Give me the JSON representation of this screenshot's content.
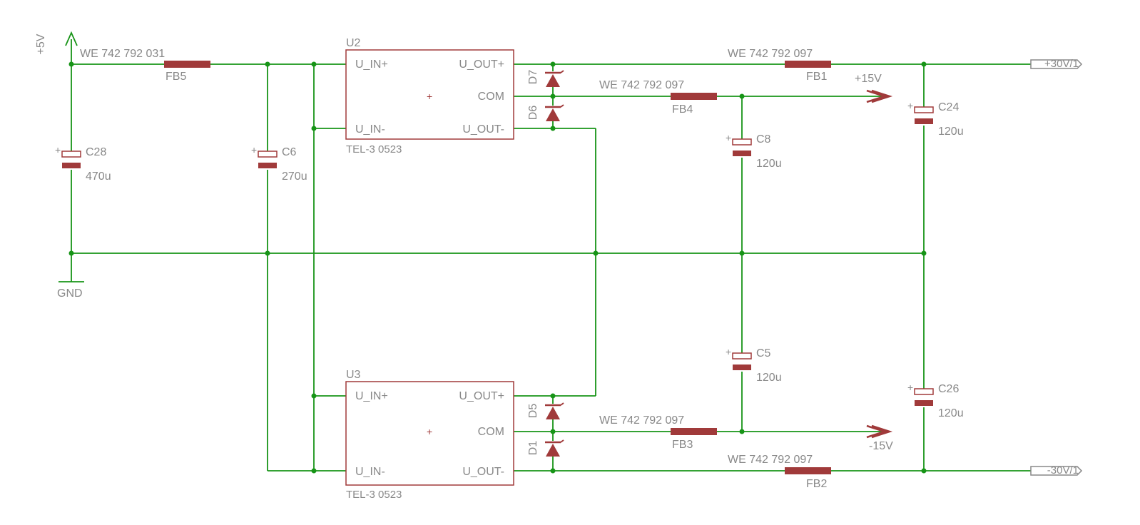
{
  "rails": {
    "plus5v": "+5V",
    "gnd": "GND",
    "plus15v": "+15V",
    "minus15v": "-15V",
    "p30v": "+30V/1",
    "m30v": "-30V/1"
  },
  "FB5": {
    "part": "WE 742 792 031",
    "name": "FB5"
  },
  "FB4": {
    "part": "WE 742 792 097",
    "name": "FB4"
  },
  "FB1": {
    "part": "WE 742 792 097",
    "name": "FB1"
  },
  "FB3": {
    "part": "WE 742 792 097",
    "name": "FB3"
  },
  "FB2": {
    "part": "WE 742 792 097",
    "name": "FB2"
  },
  "C28": {
    "name": "C28",
    "value": "470u"
  },
  "C6": {
    "name": "C6",
    "value": "270u"
  },
  "C8": {
    "name": "C8",
    "value": "120u"
  },
  "C24": {
    "name": "C24",
    "value": "120u"
  },
  "C5": {
    "name": "C5",
    "value": "120u"
  },
  "C26": {
    "name": "C26",
    "value": "120u"
  },
  "U2": {
    "ref": "U2",
    "model": "TEL-3 0523",
    "pin_inp": "U_IN+",
    "pin_inn": "U_IN-",
    "pin_outp": "U_OUT+",
    "pin_com": "COM",
    "pin_outn": "U_OUT-",
    "plus": "+"
  },
  "U3": {
    "ref": "U3",
    "model": "TEL-3 0523",
    "pin_inp": "U_IN+",
    "pin_inn": "U_IN-",
    "pin_outp": "U_OUT+",
    "pin_com": "COM",
    "pin_outn": "U_OUT-",
    "plus": "+"
  },
  "D7": "D7",
  "D6": "D6",
  "D5": "D5",
  "D1": "D1"
}
